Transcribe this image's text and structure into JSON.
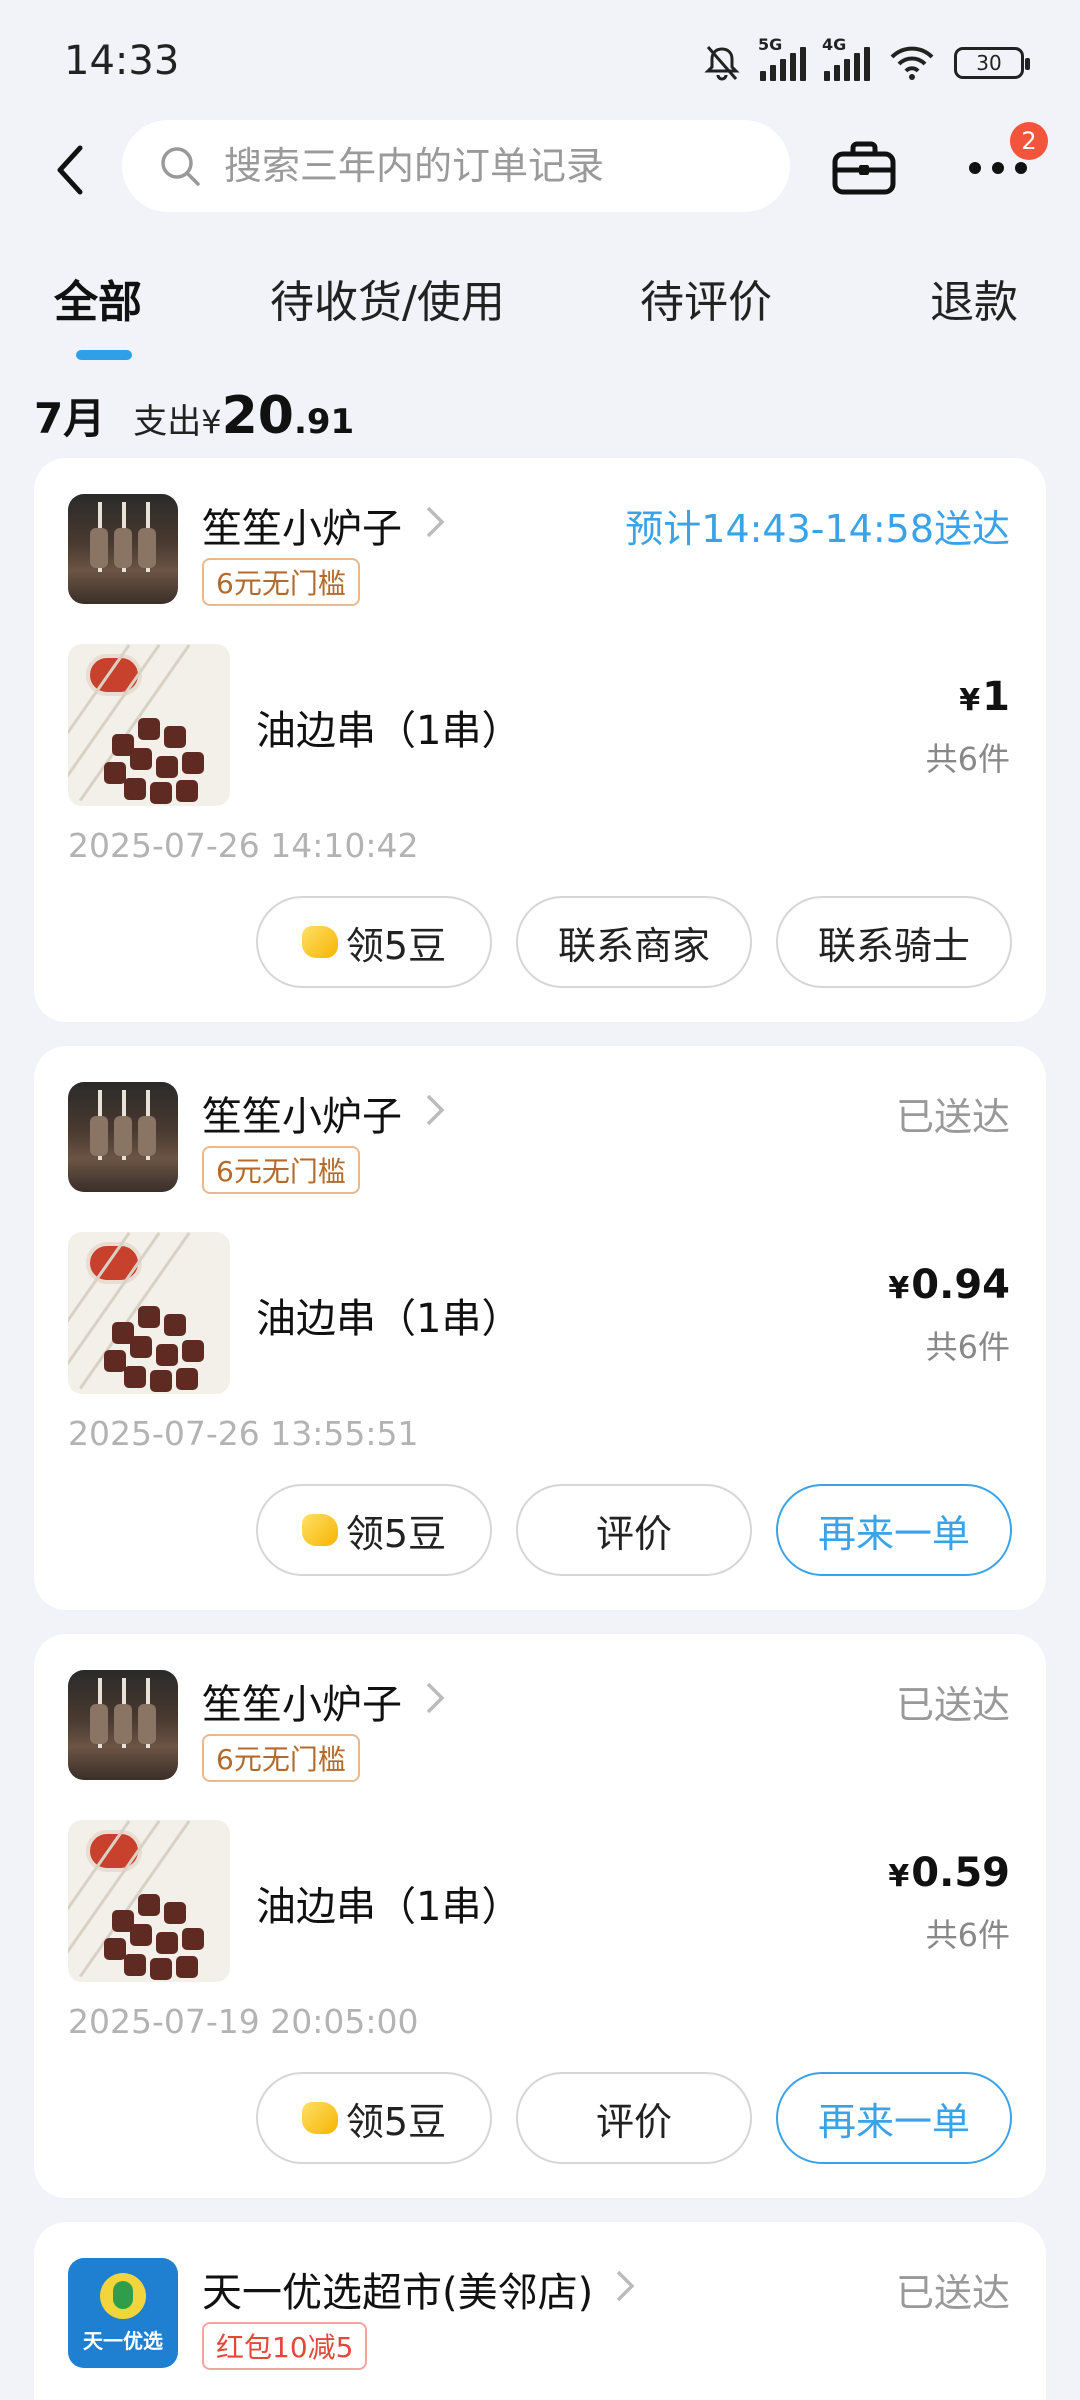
{
  "status_bar": {
    "time": "14:33",
    "battery": "30",
    "net_5g": "5G",
    "net_4g": "4G"
  },
  "search": {
    "placeholder": "搜索三年内的订单记录"
  },
  "header": {
    "notification_count": "2"
  },
  "tabs": [
    {
      "label": "全部",
      "active": true
    },
    {
      "label": "待收货/使用",
      "active": false
    },
    {
      "label": "待评价",
      "active": false
    },
    {
      "label": "退款",
      "active": false
    }
  ],
  "summary": {
    "month": "7月",
    "spend_label": "支出",
    "yen": "¥",
    "amount_int": "20",
    "amount_dec": ".91"
  },
  "orders": [
    {
      "store_name": "笙笙小炉子",
      "promo": "6元无门槛",
      "status": "预计14:43-14:58送达",
      "item_name": "油边串（1串）",
      "price": "1",
      "count": "共6件",
      "time": "2025-07-26 14:10:42",
      "buttons": [
        "领5豆",
        "联系商家",
        "联系骑士"
      ]
    },
    {
      "store_name": "笙笙小炉子",
      "promo": "6元无门槛",
      "status": "已送达",
      "item_name": "油边串（1串）",
      "price": "0.94",
      "count": "共6件",
      "time": "2025-07-26 13:55:51",
      "buttons": [
        "领5豆",
        "评价",
        "再来一单"
      ]
    },
    {
      "store_name": "笙笙小炉子",
      "promo": "6元无门槛",
      "status": "已送达",
      "item_name": "油边串（1串）",
      "price": "0.59",
      "count": "共6件",
      "time": "2025-07-19 20:05:00",
      "buttons": [
        "领5豆",
        "评价",
        "再来一单"
      ]
    },
    {
      "store_name": "天一优选超市(美邻店)",
      "promo": "红包10减5",
      "status": "已送达",
      "logo_text": "天一优选"
    }
  ],
  "colors": {
    "accent": "#3aa3e8",
    "badge": "#f2553b",
    "promo_orange": "#b36a2b",
    "promo_red": "#e5473b"
  }
}
